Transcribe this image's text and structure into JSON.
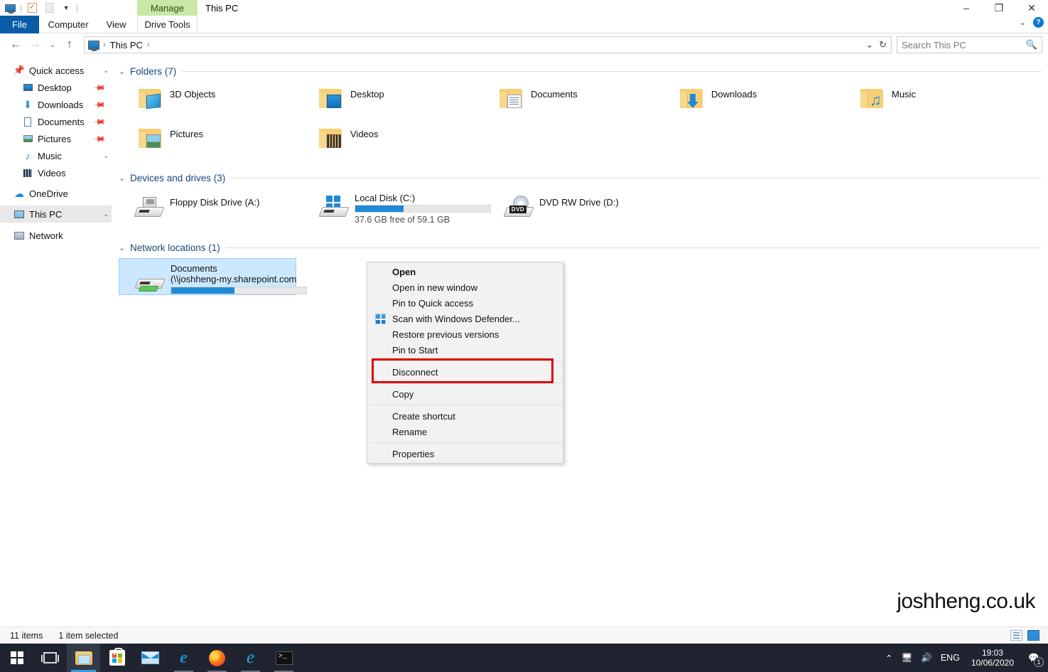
{
  "window": {
    "title": "This PC",
    "contextual_tab_group": "Manage",
    "minimize": "–",
    "restore": "❐",
    "close": "✕",
    "collapse_ribbon": "⌄",
    "help": "?"
  },
  "quick_access_toolbar": {
    "icons": [
      "this-pc-icon",
      "properties-icon",
      "new-folder-icon",
      "customize-dropdown-icon"
    ]
  },
  "ribbon": {
    "tabs": [
      {
        "label": "File",
        "id": "file"
      },
      {
        "label": "Computer",
        "id": "computer"
      },
      {
        "label": "View",
        "id": "view"
      },
      {
        "label": "Drive Tools",
        "id": "drivetools"
      }
    ]
  },
  "navigation": {
    "back": "←",
    "forward": "→",
    "recent": "⌄",
    "up": "↑",
    "breadcrumb": {
      "root_icon": "this-pc-icon",
      "items": [
        "This PC"
      ],
      "separator": "›"
    },
    "history_dropdown": "⌄",
    "refresh": "↻"
  },
  "search": {
    "placeholder": "Search This PC",
    "value": "",
    "icon": "search-icon"
  },
  "sidebar": {
    "items": [
      {
        "label": "Quick access",
        "icon": "pin-star-icon",
        "indent": false,
        "pinned": false,
        "selected": false
      },
      {
        "label": "Desktop",
        "icon": "desktop-icon",
        "indent": true,
        "pinned": true,
        "selected": false
      },
      {
        "label": "Downloads",
        "icon": "downloads-icon",
        "indent": true,
        "pinned": true,
        "selected": false
      },
      {
        "label": "Documents",
        "icon": "documents-icon",
        "indent": true,
        "pinned": true,
        "selected": false
      },
      {
        "label": "Pictures",
        "icon": "pictures-icon",
        "indent": true,
        "pinned": true,
        "selected": false
      },
      {
        "label": "Music",
        "icon": "music-icon",
        "indent": true,
        "pinned": false,
        "selected": false
      },
      {
        "label": "Videos",
        "icon": "videos-icon",
        "indent": true,
        "pinned": false,
        "selected": false
      },
      {
        "label": "OneDrive",
        "icon": "onedrive-cloud-icon",
        "indent": false,
        "pinned": false,
        "selected": false
      },
      {
        "label": "This PC",
        "icon": "this-pc-icon",
        "indent": false,
        "pinned": false,
        "selected": true
      },
      {
        "label": "Network",
        "icon": "network-icon",
        "indent": false,
        "pinned": false,
        "selected": false
      }
    ]
  },
  "content": {
    "groups": [
      {
        "id": "folders",
        "label": "Folders (7)",
        "chevron": "⌄"
      },
      {
        "id": "drives",
        "label": "Devices and drives (3)",
        "chevron": "⌄"
      },
      {
        "id": "network",
        "label": "Network locations (1)",
        "chevron": "⌄"
      }
    ],
    "folders": [
      {
        "name": "3D Objects",
        "icon": "folder-3d-objects-icon"
      },
      {
        "name": "Desktop",
        "icon": "folder-desktop-icon"
      },
      {
        "name": "Documents",
        "icon": "folder-documents-icon"
      },
      {
        "name": "Downloads",
        "icon": "folder-downloads-icon"
      },
      {
        "name": "Music",
        "icon": "folder-music-icon"
      },
      {
        "name": "Pictures",
        "icon": "folder-pictures-icon"
      },
      {
        "name": "Videos",
        "icon": "folder-videos-icon"
      }
    ],
    "drives": [
      {
        "name": "Floppy Disk Drive (A:)",
        "icon": "floppy-drive-icon",
        "has_bar": false,
        "free_text": ""
      },
      {
        "name": "Local Disk (C:)",
        "icon": "local-disk-icon",
        "has_bar": true,
        "fill_percent": 36,
        "free_text": "37.6 GB free of 59.1 GB"
      },
      {
        "name": "DVD RW Drive (D:)",
        "icon": "dvd-drive-icon",
        "has_bar": false,
        "free_text": ""
      }
    ],
    "network_locations": [
      {
        "name": "Documents",
        "path": "(\\\\joshheng-my.sharepoint.com",
        "icon": "network-drive-icon",
        "has_bar": true,
        "fill_percent": 47,
        "selected": true
      }
    ]
  },
  "context_menu": {
    "items": [
      {
        "label": "Open",
        "bold": true,
        "icon": null,
        "separator_before": false,
        "highlighted": false
      },
      {
        "label": "Open in new window",
        "bold": false,
        "icon": null,
        "separator_before": false,
        "highlighted": false
      },
      {
        "label": "Pin to Quick access",
        "bold": false,
        "icon": null,
        "separator_before": false,
        "highlighted": false
      },
      {
        "label": "Scan with Windows Defender...",
        "bold": false,
        "icon": "windows-defender-icon",
        "separator_before": false,
        "highlighted": false
      },
      {
        "label": "Restore previous versions",
        "bold": false,
        "icon": null,
        "separator_before": false,
        "highlighted": false
      },
      {
        "label": "Pin to Start",
        "bold": false,
        "icon": null,
        "separator_before": false,
        "highlighted": false
      },
      {
        "label": "Disconnect",
        "bold": false,
        "icon": null,
        "separator_before": true,
        "highlighted": true
      },
      {
        "label": "Copy",
        "bold": false,
        "icon": null,
        "separator_before": true,
        "highlighted": false
      },
      {
        "label": "Create shortcut",
        "bold": false,
        "icon": null,
        "separator_before": true,
        "highlighted": false
      },
      {
        "label": "Rename",
        "bold": false,
        "icon": null,
        "separator_before": false,
        "highlighted": false
      },
      {
        "label": "Properties",
        "bold": false,
        "icon": null,
        "separator_before": true,
        "highlighted": false
      }
    ],
    "highlight_color": "#e00000"
  },
  "status_bar": {
    "item_count": "11 items",
    "selection": "1 item selected",
    "view_details_icon": "details-view-icon",
    "view_tiles_icon": "tiles-view-icon"
  },
  "watermark": "joshheng.co.uk",
  "taskbar": {
    "items": [
      {
        "name": "start-button",
        "icon": "windows-logo-icon",
        "state": "none"
      },
      {
        "name": "task-view-button",
        "icon": "task-view-icon",
        "state": "none"
      },
      {
        "name": "file-explorer-button",
        "icon": "file-explorer-icon",
        "state": "active"
      },
      {
        "name": "microsoft-store-button",
        "icon": "microsoft-store-icon",
        "state": "none"
      },
      {
        "name": "mail-button",
        "icon": "mail-icon",
        "state": "none"
      },
      {
        "name": "edge-legacy-button",
        "icon": "edge-legacy-icon",
        "state": "open"
      },
      {
        "name": "firefox-button",
        "icon": "firefox-icon",
        "state": "open"
      },
      {
        "name": "internet-explorer-button",
        "icon": "internet-explorer-icon",
        "state": "open"
      },
      {
        "name": "command-prompt-button",
        "icon": "command-prompt-icon",
        "state": "open"
      }
    ],
    "tray": {
      "show_hidden": "⌃",
      "network_icon": "network-tray-icon",
      "volume_icon": "volume-icon",
      "language": "ENG",
      "time": "19:03",
      "date": "10/06/2020",
      "notifications_icon": "notifications-icon",
      "notification_count": "1"
    }
  },
  "colors": {
    "accent_blue": "#1f8ad6",
    "file_tab_blue": "#0a5ca8",
    "manage_green": "#c9e8a6",
    "selection_blue": "#cce8ff",
    "group_header": "#19487a",
    "highlight_red": "#e00000",
    "taskbar_bg": "#1f2430"
  }
}
